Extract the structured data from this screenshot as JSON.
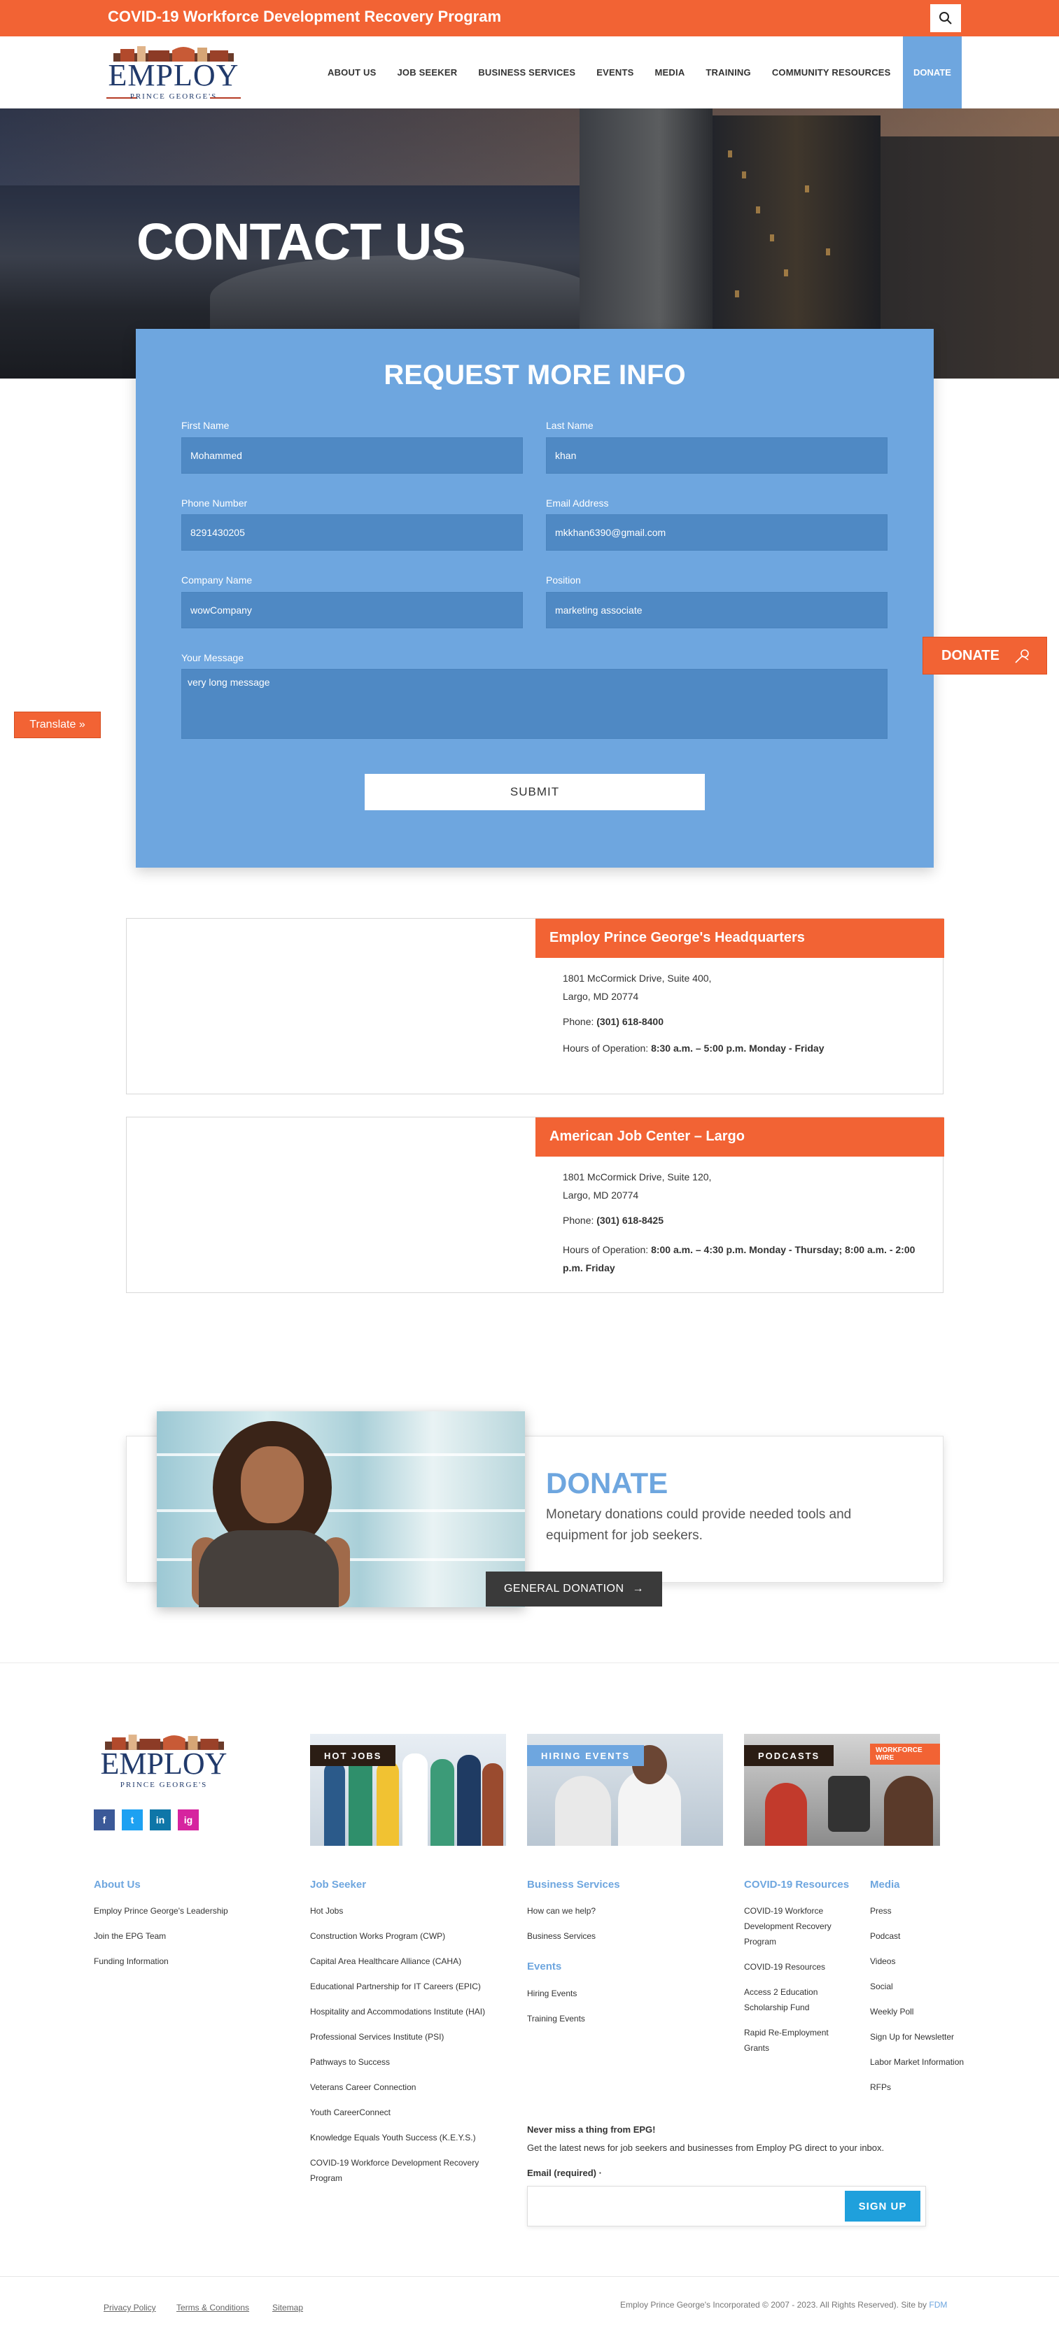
{
  "top_banner": {
    "title": "COVID-19 Workforce Development Recovery Program"
  },
  "logo": {
    "name": "EMPLOY",
    "sub": "PRINCE GEORGE'S"
  },
  "nav": {
    "items": [
      "ABOUT US",
      "JOB SEEKER",
      "BUSINESS SERVICES",
      "EVENTS",
      "MEDIA",
      "TRAINING",
      "COMMUNITY RESOURCES"
    ],
    "donate": "DONATE"
  },
  "hero": {
    "title": "CONTACT US"
  },
  "form": {
    "title": "REQUEST MORE INFO",
    "first_name": {
      "label": "First Name",
      "value": "Mohammed"
    },
    "last_name": {
      "label": "Last Name",
      "value": "khan"
    },
    "phone": {
      "label": "Phone Number",
      "value": "8291430205"
    },
    "email": {
      "label": "Email Address",
      "value": "mkkhan6390@gmail.com"
    },
    "company": {
      "label": "Company Name",
      "value": "wowCompany"
    },
    "position": {
      "label": "Position",
      "value": "marketing associate"
    },
    "message": {
      "label": "Your Message",
      "value": "very long message"
    },
    "submit": "SUBMIT"
  },
  "side": {
    "donate": "DONATE",
    "translate": "Translate »"
  },
  "locations": [
    {
      "title": "Employ Prince George's Headquarters",
      "address1": "1801 McCormick Drive, Suite 400,",
      "address2": "Largo, MD 20774",
      "phone_label": "Phone: ",
      "phone": "(301) 618-8400",
      "hours_label": "Hours of Operation: ",
      "hours": "8:30 a.m. – 5:00 p.m. Monday - Friday"
    },
    {
      "title": "American Job Center – Largo",
      "address1": "1801 McCormick Drive, Suite 120,",
      "address2": "Largo, MD 20774",
      "phone_label": "Phone: ",
      "phone": "(301) 618-8425",
      "hours_label": "Hours of Operation: ",
      "hours": "8:00 a.m. – 4:30 p.m. Monday - Thursday; 8:00 a.m. - 2:00 p.m. Friday"
    }
  ],
  "donate_section": {
    "title": "DONATE",
    "text": "Monetary donations could provide needed tools and equipment for job seekers.",
    "button": "GENERAL DONATION"
  },
  "footer": {
    "social": [
      "f",
      "t",
      "in",
      "ig"
    ],
    "promos": [
      {
        "tag": "HOT JOBS"
      },
      {
        "tag": "HIRING EVENTS"
      },
      {
        "tag": "PODCASTS",
        "badge": "WORKFORCE WIRE"
      }
    ],
    "about": {
      "title": "About Us",
      "links": [
        "Employ Prince George's Leadership",
        "Join the EPG Team",
        "Funding Information"
      ]
    },
    "job_seeker": {
      "title": "Job Seeker",
      "links": [
        "Hot Jobs",
        "Construction Works Program (CWP)",
        "Capital Area Healthcare Alliance (CAHA)",
        "Educational Partnership for IT Careers (EPIC)",
        "Hospitality and Accommodations Institute (HAI)",
        "Professional Services Institute (PSI)",
        "Pathways to Success",
        "Veterans Career Connection",
        "Youth CareerConnect",
        "Knowledge Equals Youth Success (K.E.Y.S.)",
        "COVID-19 Workforce Development Recovery",
        "Program"
      ]
    },
    "business": {
      "title": "Business Services",
      "links": [
        "How can we help?",
        "Business Services"
      ]
    },
    "events": {
      "title": "Events",
      "links": [
        "Hiring Events",
        "Training Events"
      ]
    },
    "covid": {
      "title": "COVID-19 Resources",
      "links": [
        "COVID-19 Workforce",
        "Development Recovery",
        "Program",
        "COVID-19 Resources",
        "Access 2 Education",
        "Scholarship Fund",
        "Rapid Re-Employment",
        "Grants"
      ]
    },
    "media": {
      "title": "Media",
      "links": [
        "Press",
        "Podcast",
        "Videos",
        "Social",
        "Weekly Poll",
        "Sign Up for Newsletter",
        "Labor Market Information",
        "RFPs"
      ]
    },
    "newsletter": {
      "title": "Never miss a thing from EPG!",
      "text": "Get the latest news for job seekers and businesses from Employ PG direct to your inbox.",
      "email_label": "Email (required) ·",
      "signup": "SIGN UP"
    },
    "legal": [
      "Privacy Policy",
      "Terms & Conditions",
      "Sitemap"
    ],
    "copyright": "Employ Prince George's Incorporated © 2007 - 2023. All Rights Reserved). Site by ",
    "copyright_link": "FDM"
  },
  "colors": {
    "accent": "#f26334",
    "blue": "#6ea6df",
    "dark": "#3a3a3a"
  }
}
